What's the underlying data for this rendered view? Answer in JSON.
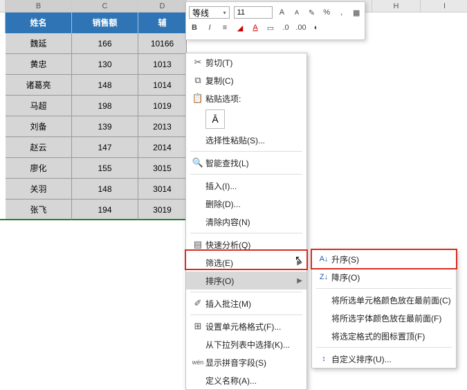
{
  "columns": {
    "B": "B",
    "C": "C",
    "D": "D",
    "H": "H",
    "I": "I"
  },
  "header": {
    "B": "姓名",
    "C": "销售额",
    "D": "辅"
  },
  "rows": [
    {
      "b": "魏延",
      "c": "166",
      "d": "10166"
    },
    {
      "b": "黄忠",
      "c": "130",
      "d": "1013"
    },
    {
      "b": "诸葛亮",
      "c": "148",
      "d": "1014"
    },
    {
      "b": "马超",
      "c": "198",
      "d": "1019"
    },
    {
      "b": "刘备",
      "c": "139",
      "d": "2013"
    },
    {
      "b": "赵云",
      "c": "147",
      "d": "2014"
    },
    {
      "b": "廖化",
      "c": "155",
      "d": "3015"
    },
    {
      "b": "关羽",
      "c": "148",
      "d": "3014"
    },
    {
      "b": "张飞",
      "c": "194",
      "d": "3019"
    }
  ],
  "mini": {
    "font": "等线",
    "size": "11",
    "A1": "A",
    "A2": "A",
    "bold": "B",
    "italic": "I",
    "pct": "%"
  },
  "menu": {
    "cut": "剪切(T)",
    "copy": "复制(C)",
    "pasteopt": "粘贴选项:",
    "pastespecial": "选择性粘贴(S)...",
    "smartfind": "智能查找(L)",
    "insert": "插入(I)...",
    "delete": "删除(D)...",
    "clear": "清除内容(N)",
    "quick": "快速分析(Q)",
    "filter": "筛选(E)",
    "sort": "排序(O)",
    "comment": "插入批注(M)",
    "format": "设置单元格格式(F)...",
    "dropdown": "从下拉列表中选择(K)...",
    "pinyin": "显示拼音字段(S)",
    "define": "定义名称(A)..."
  },
  "submenu": {
    "asc": "升序(S)",
    "desc": "降序(O)",
    "c1": "将所选单元格颜色放在最前面(C)",
    "c2": "将所选字体颜色放在最前面(F)",
    "c3": "将选定格式的图标置顶(F)",
    "custom": "自定义排序(U)..."
  }
}
